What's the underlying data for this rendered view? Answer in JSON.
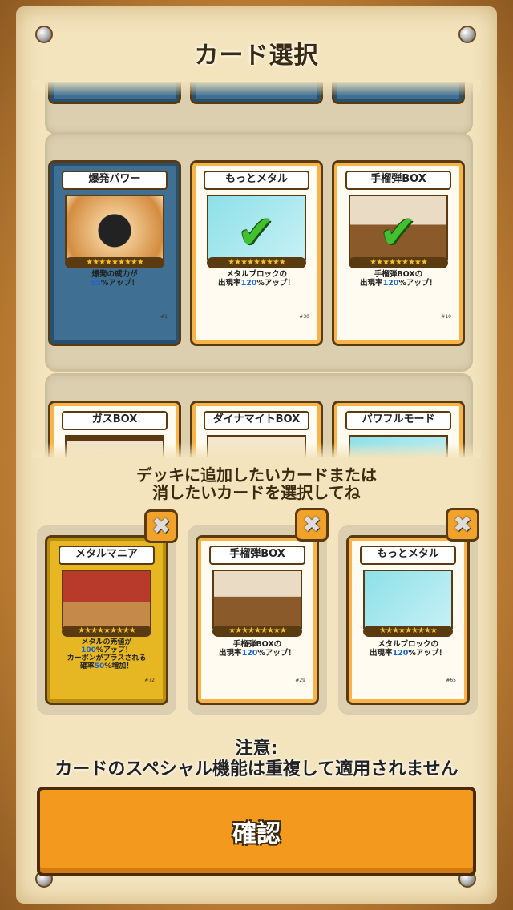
{
  "title": "カード選択",
  "available_cards": [
    {
      "name": "",
      "variant": "blue"
    },
    {
      "name": "",
      "variant": "blue"
    },
    {
      "name": "",
      "variant": "blue"
    },
    {
      "name": "爆発パワー",
      "variant": "blue",
      "stars": "★★★★★★★★★",
      "desc_line1": "爆発の威力が",
      "desc_value": "55",
      "desc_line2_suffix": "%アップ！",
      "number": "#1",
      "selected": false
    },
    {
      "name": "もっとメタル",
      "variant": "white",
      "stars": "★★★★★★★★★",
      "desc_line1": "メタルブロックの",
      "desc_prefix": "出現率",
      "desc_value": "120",
      "desc_line2_suffix": "%アップ！",
      "number": "#30",
      "selected": true
    },
    {
      "name": "手榴弾BOX",
      "variant": "white",
      "stars": "★★★★★★★★★",
      "desc_line1": "手榴弾BOXの",
      "desc_prefix": "出現率",
      "desc_value": "120",
      "desc_line2_suffix": "%アップ！",
      "number": "#10",
      "selected": true
    },
    {
      "name": "ガスBOX",
      "variant": "white"
    },
    {
      "name": "ダイナマイトBOX",
      "variant": "white"
    },
    {
      "name": "パワフルモード",
      "variant": "white"
    }
  ],
  "instruction": {
    "line1": "デッキに追加したいカードまたは",
    "line2": "消したいカードを選択してね"
  },
  "deck_cards": [
    {
      "name": "メタルマニア",
      "variant": "gold",
      "stars": "★★★★★★★★★",
      "desc": [
        "メタルの売値が",
        "%アップ！",
        "カーボンがプラスされる",
        "確率",
        "%増加！"
      ],
      "value1": "100",
      "value2": "50",
      "number": "#72"
    },
    {
      "name": "手榴弾BOX",
      "variant": "white",
      "stars": "★★★★★★★★★",
      "desc_line1": "手榴弾BOXの",
      "desc_prefix": "出現率",
      "desc_value": "120",
      "desc_line2_suffix": "%アップ！",
      "number": "#29"
    },
    {
      "name": "もっとメタル",
      "variant": "white",
      "stars": "★★★★★★★★★",
      "desc_line1": "メタルブロックの",
      "desc_prefix": "出現率",
      "desc_value": "120",
      "desc_line2_suffix": "%アップ！",
      "number": "#65"
    }
  ],
  "remove_icon": "✖",
  "note": {
    "line1": "注意:",
    "line2": "カードのスペシャル機能は重複して適用されません"
  },
  "confirm_label": "確認",
  "colors": {
    "confirm": "#f39a1e",
    "highlight": "#1c68c8",
    "check": "#42c030"
  }
}
